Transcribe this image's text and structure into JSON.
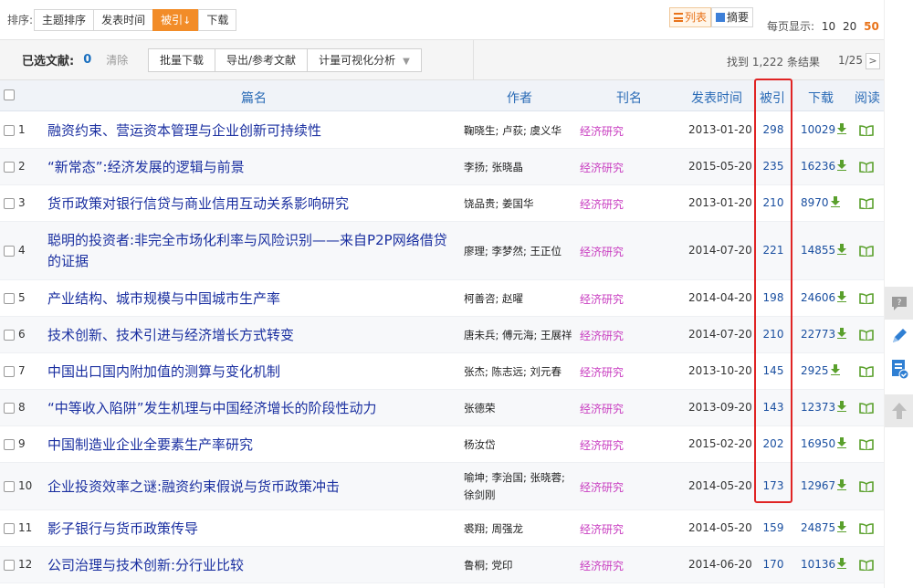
{
  "sort": {
    "label": "排序:",
    "options": [
      {
        "label": "主题排序"
      },
      {
        "label": "发表时间"
      },
      {
        "label": "被引",
        "arrow": "↓",
        "active": true
      },
      {
        "label": "下载"
      }
    ]
  },
  "view": {
    "list_label": "列表",
    "summary_label": "摘要"
  },
  "per_page": {
    "label": "每页显示:",
    "options": [
      "10",
      "20",
      "50"
    ],
    "selected": "50"
  },
  "selection": {
    "label": "已选文献:",
    "count": "0",
    "clear": "清除",
    "tools": [
      "批量下载",
      "导出/参考文献",
      "计量可视化分析"
    ],
    "results": "找到 1,222 条结果",
    "page": "1/25",
    "next": ">"
  },
  "columns": {
    "title": "篇名",
    "author": "作者",
    "journal": "刊名",
    "date": "发表时间",
    "cited": "被引",
    "downloads": "下载",
    "read": "阅读"
  },
  "rows": [
    {
      "num": "1",
      "title": "融资约束、营运资本管理与企业创新可持续性",
      "authors": "鞠晓生; 卢荻; 虞义华",
      "journal": "经济研究",
      "date": "2013-01-20",
      "cited": "298",
      "downloads": "10029"
    },
    {
      "num": "2",
      "title": "“新常态”:经济发展的逻辑与前景",
      "authors": "李扬; 张晓晶",
      "journal": "经济研究",
      "date": "2015-05-20",
      "cited": "235",
      "downloads": "16236"
    },
    {
      "num": "3",
      "title": "货币政策对银行信贷与商业信用互动关系影响研究",
      "authors": "饶品贵; 姜国华",
      "journal": "经济研究",
      "date": "2013-01-20",
      "cited": "210",
      "downloads": "8970"
    },
    {
      "num": "4",
      "title": "聪明的投资者:非完全市场化利率与风险识别——来自P2P网络借贷的证据",
      "authors": "廖理; 李梦然; 王正位",
      "journal": "经济研究",
      "date": "2014-07-20",
      "cited": "221",
      "downloads": "14855"
    },
    {
      "num": "5",
      "title": "产业结构、城市规模与中国城市生产率",
      "authors": "柯善咨; 赵曜",
      "journal": "经济研究",
      "date": "2014-04-20",
      "cited": "198",
      "downloads": "24606"
    },
    {
      "num": "6",
      "title": "技术创新、技术引进与经济增长方式转变",
      "authors": "唐未兵; 傅元海; 王展祥",
      "journal": "经济研究",
      "date": "2014-07-20",
      "cited": "210",
      "downloads": "22773"
    },
    {
      "num": "7",
      "title": "中国出口国内附加值的测算与变化机制",
      "authors": "张杰; 陈志远; 刘元春",
      "journal": "经济研究",
      "date": "2013-10-20",
      "cited": "145",
      "downloads": "2925"
    },
    {
      "num": "8",
      "title": "“中等收入陷阱”发生机理与中国经济增长的阶段性动力",
      "authors": "张德荣",
      "journal": "经济研究",
      "date": "2013-09-20",
      "cited": "143",
      "downloads": "12373"
    },
    {
      "num": "9",
      "title": "中国制造业企业全要素生产率研究",
      "authors": "杨汝岱",
      "journal": "经济研究",
      "date": "2015-02-20",
      "cited": "202",
      "downloads": "16950"
    },
    {
      "num": "10",
      "title": "企业投资效率之谜:融资约束假说与货币政策冲击",
      "authors": "喻坤; 李治国; 张晓蓉; 徐剑刚",
      "journal": "经济研究",
      "date": "2014-05-20",
      "cited": "173",
      "downloads": "12967"
    },
    {
      "num": "11",
      "title": "影子银行与货币政策传导",
      "authors": "裘翔; 周强龙",
      "journal": "经济研究",
      "date": "2014-05-20",
      "cited": "159",
      "downloads": "24875"
    },
    {
      "num": "12",
      "title": "公司治理与技术创新:分行业比较",
      "authors": "鲁桐; 党印",
      "journal": "经济研究",
      "date": "2014-06-20",
      "cited": "170",
      "downloads": "10136"
    }
  ],
  "colors": {
    "accent": "#f28c28",
    "link": "#1a2fa0",
    "journal": "#c83cc0",
    "highlight": "#e02424",
    "download": "#5aa02c"
  },
  "side_tools": [
    "comment-icon",
    "edit-icon",
    "checklist-icon",
    "back-to-top-icon"
  ]
}
